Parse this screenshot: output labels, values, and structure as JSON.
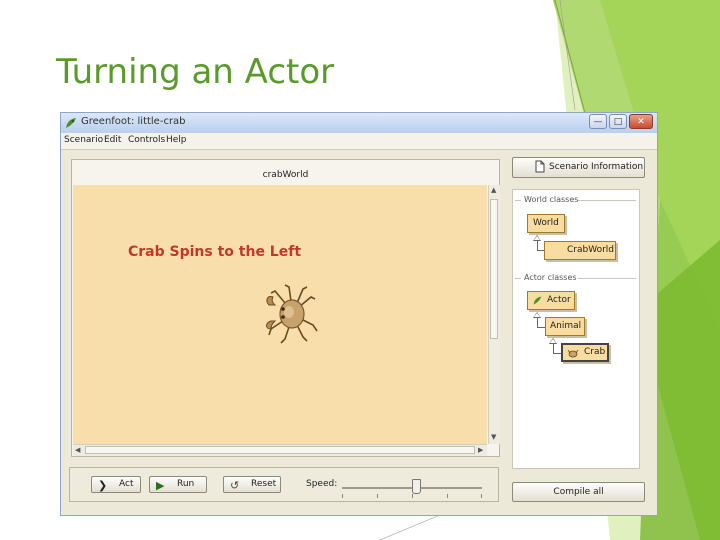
{
  "slide": {
    "title": "Turning an Actor",
    "accent_color": "#5a9a2a"
  },
  "window": {
    "title": "Greenfoot: little-crab",
    "buttons": [
      "minimize",
      "maximize",
      "close"
    ]
  },
  "menu": {
    "items": [
      "Scenario",
      "Edit",
      "Controls",
      "Help"
    ]
  },
  "world": {
    "label": "crabWorld",
    "background_color": "#f8deaa",
    "annotation": "Crab Spins to the Left",
    "annotation_color": "#c0392b",
    "actor_icon": "crab-icon"
  },
  "controls": {
    "act_label": "Act",
    "run_label": "Run",
    "reset_label": "Reset",
    "speed_label": "Speed:",
    "speed_fraction": 0.53
  },
  "sidebar": {
    "scenario_info_label": "Scenario Information",
    "world_classes_label": "World classes",
    "actor_classes_label": "Actor classes",
    "world_classes": [
      "World",
      "CrabWorld"
    ],
    "actor_classes": [
      "Actor",
      "Animal",
      "Crab"
    ],
    "compile_label": "Compile all"
  }
}
